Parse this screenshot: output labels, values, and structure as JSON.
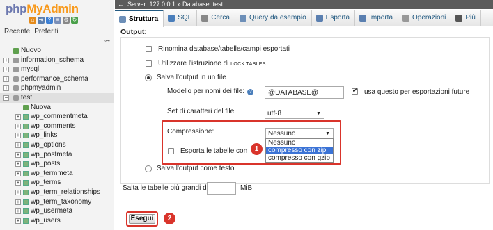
{
  "nav": {
    "logo_part1": "php",
    "logo_part2": "MyAdmin",
    "tabs": [
      "Recente",
      "Preferiti"
    ],
    "tree": [
      {
        "label": "Nuovo",
        "type": "new",
        "child": false
      },
      {
        "label": "information_schema",
        "type": "db",
        "child": false
      },
      {
        "label": "mysql",
        "type": "db",
        "child": false
      },
      {
        "label": "performance_schema",
        "type": "db",
        "child": false
      },
      {
        "label": "phpmyadmin",
        "type": "db",
        "child": false
      },
      {
        "label": "test",
        "type": "db",
        "child": false,
        "selected": true,
        "expanded": true
      },
      {
        "label": "Nuova",
        "type": "new",
        "child": true
      },
      {
        "label": "wp_commentmeta",
        "type": "table",
        "child": true
      },
      {
        "label": "wp_comments",
        "type": "table",
        "child": true
      },
      {
        "label": "wp_links",
        "type": "table",
        "child": true
      },
      {
        "label": "wp_options",
        "type": "table",
        "child": true
      },
      {
        "label": "wp_postmeta",
        "type": "table",
        "child": true
      },
      {
        "label": "wp_posts",
        "type": "table",
        "child": true
      },
      {
        "label": "wp_termmeta",
        "type": "table",
        "child": true
      },
      {
        "label": "wp_terms",
        "type": "table",
        "child": true
      },
      {
        "label": "wp_term_relationships",
        "type": "table",
        "child": true
      },
      {
        "label": "wp_term_taxonomy",
        "type": "table",
        "child": true
      },
      {
        "label": "wp_usermeta",
        "type": "table",
        "child": true
      },
      {
        "label": "wp_users",
        "type": "table",
        "child": true
      }
    ]
  },
  "topbar": {
    "back": "←",
    "breadcrumb": "Server: 127.0.0.1 » Database: test"
  },
  "tabs": [
    {
      "label": "Struttura",
      "icon": "structure-icon",
      "active": true
    },
    {
      "label": "SQL",
      "icon": "sql-icon"
    },
    {
      "label": "Cerca",
      "icon": "search-icon"
    },
    {
      "label": "Query da esempio",
      "icon": "query-icon"
    },
    {
      "label": "Esporta",
      "icon": "export-icon"
    },
    {
      "label": "Importa",
      "icon": "import-icon"
    },
    {
      "label": "Operazioni",
      "icon": "wrench-icon"
    },
    {
      "label": "Più",
      "icon": "chevron-down-icon"
    }
  ],
  "main": {
    "output_title": "Output:",
    "rename_label": "Rinomina database/tabelle/campi esportati",
    "lock_label_prefix": "Utilizzare l'istruzione di",
    "lock_label_keyword": "LOCK TABLES",
    "save_file_label": "Salva l'output in un file",
    "filename_template_label": "Modello per nomi dei file:",
    "filename_template_value": "@DATABASE@",
    "remember_template_label": "usa questo per esportazioni future",
    "charset_label": "Set di caratteri del file:",
    "charset_value": "utf-8",
    "compression_label": "Compressione:",
    "compression_value": "Nessuno",
    "compression_options": [
      "Nessuno",
      "compresso con zip",
      "compresso con gzip"
    ],
    "compression_highlighted": "compresso con zip",
    "separate_files_label": "Esporta le tabelle come file separati",
    "save_text_label": "Salva l'output come testo",
    "skip_tables_label": "Salta le tabelle più grandi di",
    "skip_tables_value": "",
    "skip_tables_unit": "MiB",
    "submit_label": "Esegui",
    "badge1": "1",
    "badge2": "2"
  },
  "colors": {
    "accent": "#235a81",
    "annotation": "#d9342b",
    "highlight": "#3b73d6"
  }
}
